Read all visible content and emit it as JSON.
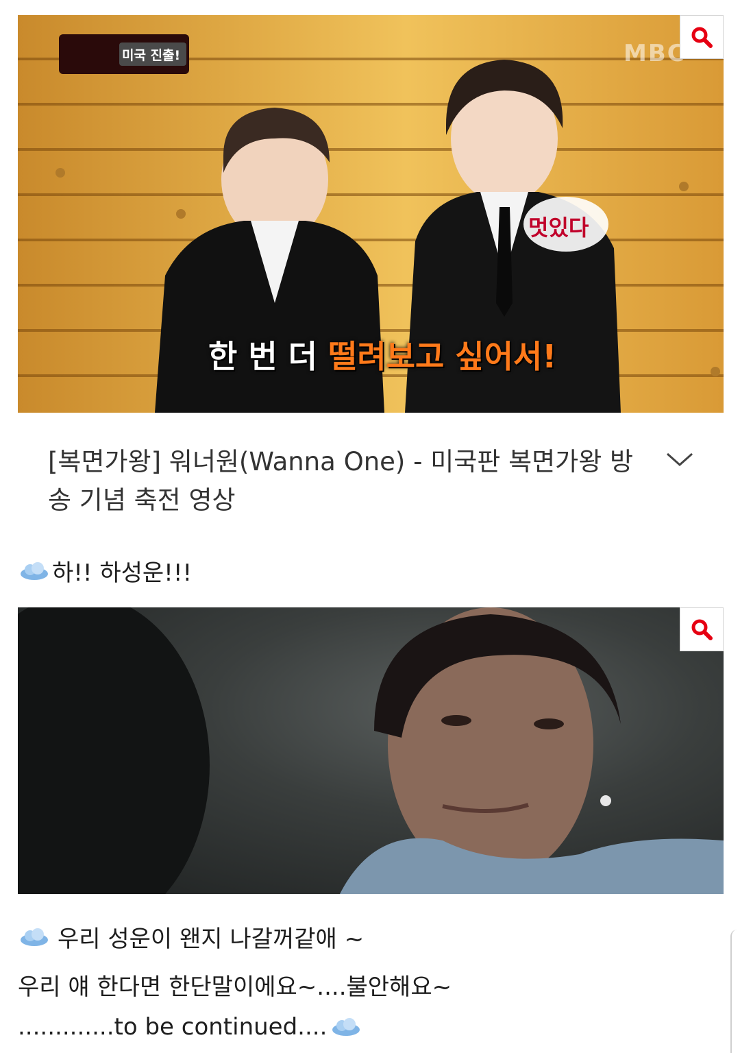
{
  "post": {
    "video_title": "[복면가왕] 워너원(Wanna One) - 미국판 복면가왕 방송 기념 축전 영상",
    "video_caption_part1": "한 번 더",
    "video_caption_part2": "떨려보고 싶어서!",
    "video_badge": "미국 진출!",
    "video_sticker": "멋있다",
    "video_logo": "MBC",
    "line1": "하!! 하성운!!!",
    "line2": "우리 성운이 왠지 나갈꺼같애 ~",
    "line3": "우리 얘 한다면 한단말이에요~....불안해요~",
    "line4": ".............to be continued...."
  },
  "icons": {
    "search": "search-icon",
    "expand": "chevron-down-icon",
    "emoticon": "cloud-emoticon-icon"
  },
  "colors": {
    "accent": "#e60012",
    "caption_highlight": "#ff7a1a",
    "text": "#1e1e1e"
  }
}
